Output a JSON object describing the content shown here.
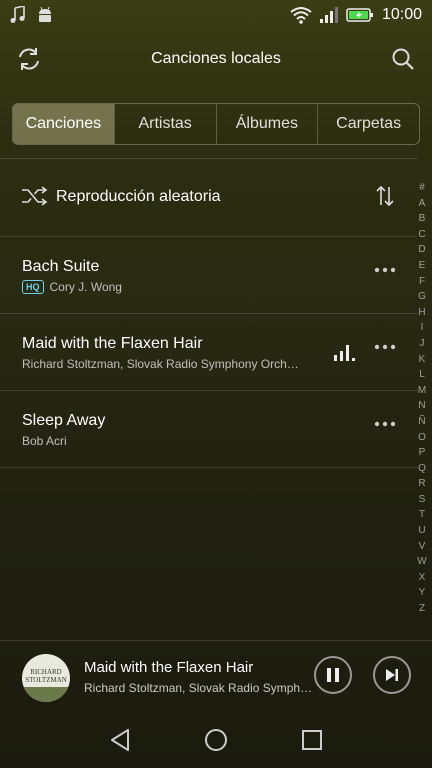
{
  "status": {
    "time": "10:00",
    "icons": [
      "music-note-icon",
      "android-icon",
      "wifi-icon",
      "signal-icon",
      "battery-charging-icon"
    ]
  },
  "header": {
    "title": "Canciones locales",
    "left_icon": "refresh-icon",
    "right_icon": "search-icon"
  },
  "tabs": [
    {
      "label": "Canciones",
      "active": true
    },
    {
      "label": "Artistas",
      "active": false
    },
    {
      "label": "Álbumes",
      "active": false
    },
    {
      "label": "Carpetas",
      "active": false
    }
  ],
  "shuffle": {
    "label": "Reproducción aleatoria",
    "icon": "shuffle-icon",
    "sort_icon": "sort-icon"
  },
  "songs": [
    {
      "title": "Bach Suite",
      "subtitle": "Cory J. Wong",
      "badge": "HQ",
      "playing": false
    },
    {
      "title": "Maid with the Flaxen Hair",
      "subtitle": "Richard Stoltzman, Slovak Radio Symphony Orch…",
      "badge": "",
      "playing": true
    },
    {
      "title": "Sleep Away",
      "subtitle": "Bob Acri",
      "badge": "",
      "playing": false
    }
  ],
  "alphabet": [
    "#",
    "A",
    "B",
    "C",
    "D",
    "E",
    "F",
    "G",
    "H",
    "I",
    "J",
    "K",
    "L",
    "M",
    "N",
    "Ñ",
    "O",
    "P",
    "Q",
    "R",
    "S",
    "T",
    "U",
    "V",
    "W",
    "X",
    "Y",
    "Z"
  ],
  "now_playing": {
    "title": "Maid with the Flaxen Hair",
    "artist": "Richard Stoltzman, Slovak Radio Symph…",
    "album_art_text": "RICHARD STOLTZMAN"
  },
  "colors": {
    "hq_badge": "#6fd1e6",
    "active_tab": "#8a8a62"
  }
}
